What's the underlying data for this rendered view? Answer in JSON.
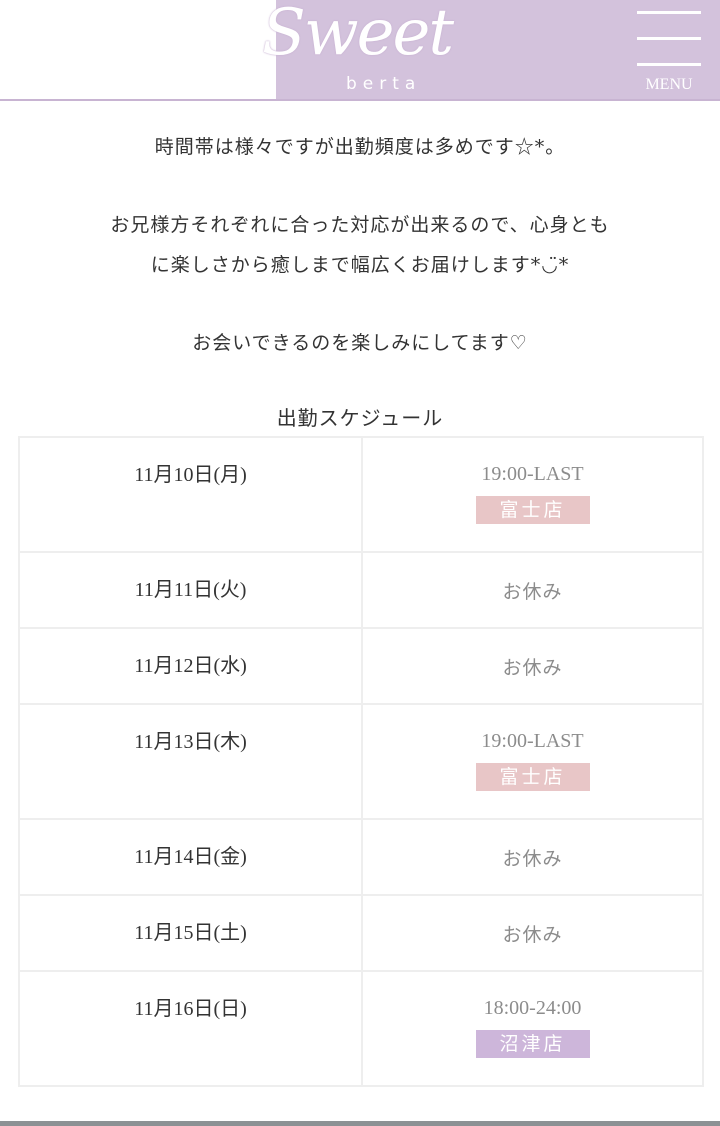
{
  "header": {
    "logo_script": "Sweet",
    "logo_sub": "berta",
    "menu_label": "MENU"
  },
  "intro": {
    "line1": "時間帯は様々ですが出勤頻度は多めです☆*。",
    "line2": "お兄様方それぞれに合った対応が出来るので、心身とも",
    "line3": "に楽しさから癒しまで幅広くお届けします*◡̈*",
    "line4": "お会いできるのを楽しみにしてます♡"
  },
  "schedule": {
    "title": "出勤スケジュール",
    "rows": [
      {
        "date": "11月10日(月)",
        "time": "19:00-LAST",
        "store": "富士店"
      },
      {
        "date": "11月11日(火)",
        "status": "お休み"
      },
      {
        "date": "11月12日(水)",
        "status": "お休み"
      },
      {
        "date": "11月13日(木)",
        "time": "19:00-LAST",
        "store": "富士店"
      },
      {
        "date": "11月14日(金)",
        "status": "お休み"
      },
      {
        "date": "11月15日(土)",
        "status": "お休み"
      },
      {
        "date": "11月16日(日)",
        "time": "18:00-24:00",
        "store": "沼津店"
      }
    ]
  },
  "colors": {
    "header_bg": "#d3c2dc",
    "fuji_badge": "#e8c6c7",
    "numazu_badge": "#cdb6da",
    "saturday": "#1f2a8f",
    "sunday": "#c62828"
  }
}
